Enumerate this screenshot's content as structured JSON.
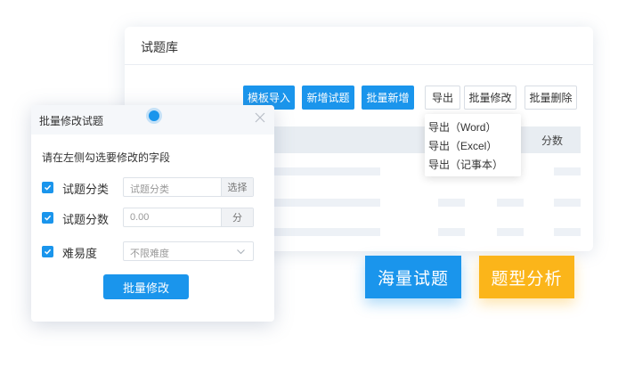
{
  "question_bank": {
    "title": "试题库",
    "toolbar": {
      "template_import": "模板导入",
      "add_question": "新增试题",
      "batch_add": "批量新增",
      "export": "导出",
      "batch_edit": "批量修改",
      "batch_delete": "批量删除"
    },
    "export_menu": [
      "导出（Word）",
      "导出（Excel）",
      "导出（记事本）"
    ],
    "table": {
      "column_header": "分数"
    }
  },
  "modal": {
    "title": "批量修改试题",
    "hint": "请在左侧勾选要修改的字段",
    "rows": [
      {
        "label": "试题分类",
        "placeholder": "试题分类",
        "addon": "选择"
      },
      {
        "label": "试题分数",
        "value": "0.00",
        "addon": "分"
      },
      {
        "label": "难易度",
        "selected": "不限难度"
      }
    ],
    "submit": "批量修改"
  },
  "promo": {
    "massive_questions": "海量试题",
    "question_analysis": "题型分析"
  },
  "colors": {
    "accent": "#1a95ec",
    "orange": "#fbb51a"
  }
}
